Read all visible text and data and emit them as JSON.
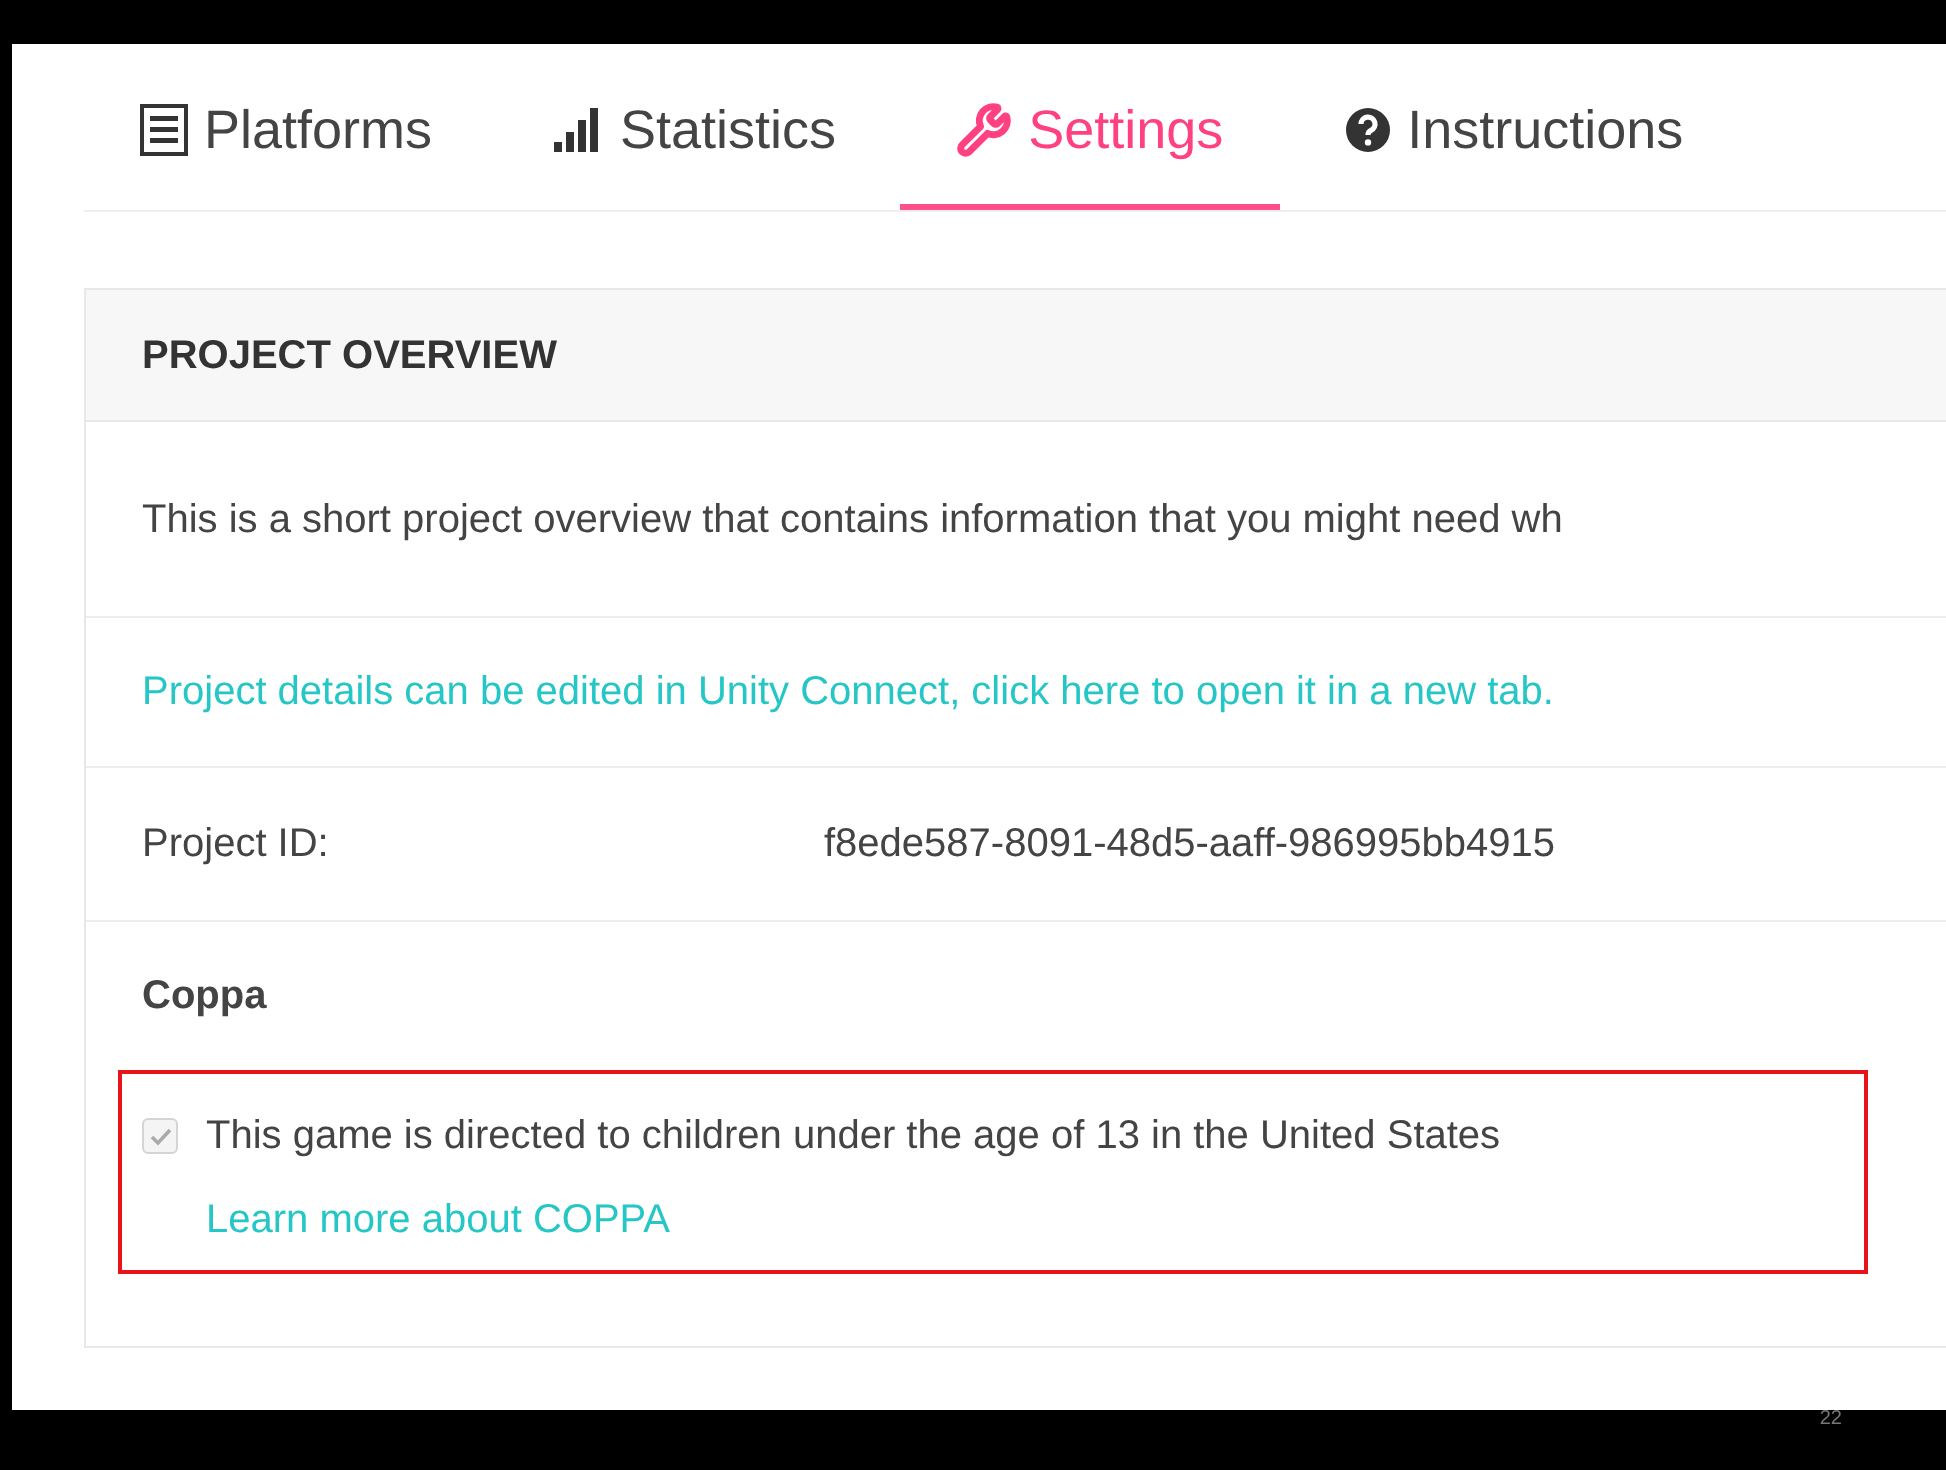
{
  "tabs": [
    {
      "label": "Platforms",
      "kind": "list",
      "selected": false
    },
    {
      "label": "Statistics",
      "kind": "bars",
      "selected": false
    },
    {
      "label": "Settings",
      "kind": "wrench",
      "selected": true
    },
    {
      "label": "Instructions",
      "kind": "question",
      "selected": false
    }
  ],
  "panel": {
    "title": "PROJECT OVERVIEW",
    "description": "This is a short project overview that contains information that you might need wh",
    "edit_link": "Project details can be edited in Unity Connect, click here to open it in a new tab.",
    "project_id": {
      "label": "Project ID:",
      "value": "f8ede587-8091-48d5-aaff-986995bb4915"
    },
    "coppa": {
      "title": "Coppa",
      "checkbox": {
        "label": "This game is directed to children under the age of 13 in the United States",
        "checked": true,
        "disabled": true
      },
      "link": "Learn more about COPPA",
      "highlighted": true
    }
  },
  "slide_number": "22"
}
